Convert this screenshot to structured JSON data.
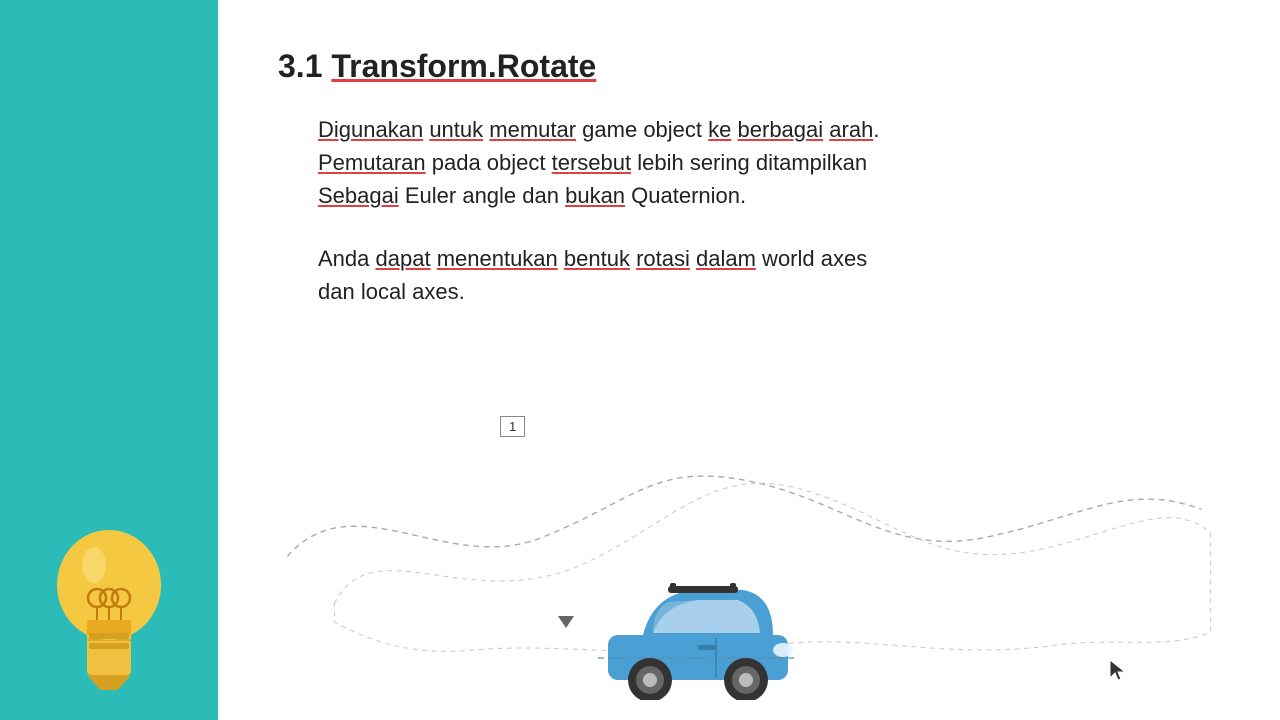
{
  "sidebar": {
    "bg_color": "#2BBCB8"
  },
  "slide": {
    "title_prefix": "3.1 ",
    "title_main": "Transform.Rotate",
    "paragraph1_line1_part1": "Digunakan untuk memutar game object ke berbagai arah.",
    "paragraph1_line2": "Pemutaran pada object tersebut lebih sering ditampilkan",
    "paragraph1_line3": "Sebagai Euler angle dan bukan Quaternion.",
    "paragraph2_line1": "Anda dapat menentukan bentuk rotasi dalam world axes",
    "paragraph2_line2": "dan local axes.",
    "number_label": "1"
  },
  "icons": {
    "bulb": "lightbulb-icon",
    "cursor": "cursor-icon",
    "triangle": "triangle-indicator-icon"
  }
}
